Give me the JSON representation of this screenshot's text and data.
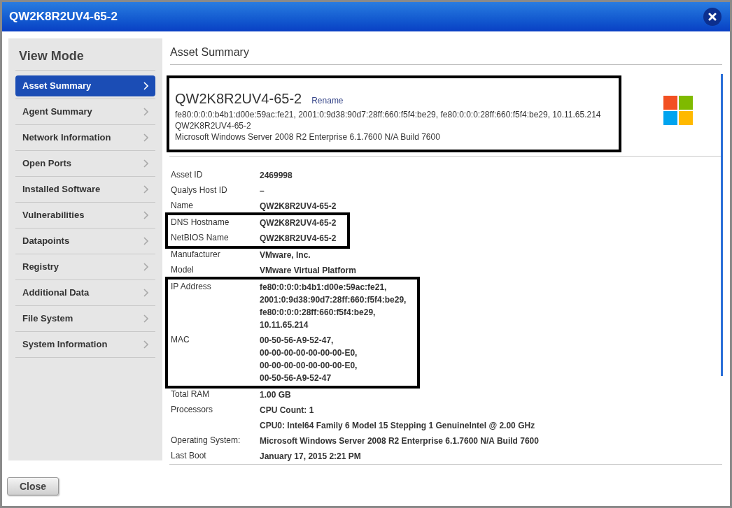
{
  "window": {
    "title": "QW2K8R2UV4-65-2"
  },
  "sidebar": {
    "title": "View Mode",
    "items": [
      {
        "label": "Asset Summary",
        "selected": true
      },
      {
        "label": "Agent Summary",
        "selected": false
      },
      {
        "label": "Network Information",
        "selected": false
      },
      {
        "label": "Open Ports",
        "selected": false
      },
      {
        "label": "Installed Software",
        "selected": false
      },
      {
        "label": "Vulnerabilities",
        "selected": false
      },
      {
        "label": "Datapoints",
        "selected": false
      },
      {
        "label": "Registry",
        "selected": false
      },
      {
        "label": "Additional Data",
        "selected": false
      },
      {
        "label": "File System",
        "selected": false
      },
      {
        "label": "System Information",
        "selected": false
      }
    ]
  },
  "content": {
    "title": "Asset Summary",
    "header": {
      "highlighted": true,
      "name": "QW2K8R2UV4-65-2",
      "rename": "Rename",
      "lines": [
        "fe80:0:0:0:b4b1:d00e:59ac:fe21, 2001:0:9d38:90d7:28ff:660:f5f4:be29, fe80:0:0:0:28ff:660:f5f4:be29, 10.11.65.214",
        "QW2K8R2UV4-65-2",
        "Microsoft Windows Server 2008 R2 Enterprise 6.1.7600 N/A Build 7600"
      ]
    },
    "groups": [
      {
        "highlighted": false,
        "rows": [
          {
            "label": "Asset ID",
            "values": [
              "2469998"
            ]
          },
          {
            "label": "Qualys Host ID",
            "values": [
              "–"
            ]
          },
          {
            "label": "Name",
            "values": [
              "QW2K8R2UV4-65-2"
            ]
          }
        ]
      },
      {
        "highlighted": true,
        "rows": [
          {
            "label": "DNS Hostname",
            "values": [
              "QW2K8R2UV4-65-2"
            ]
          },
          {
            "label": "NetBIOS Name",
            "values": [
              "QW2K8R2UV4-65-2"
            ]
          }
        ]
      },
      {
        "highlighted": false,
        "rows": [
          {
            "label": "Manufacturer",
            "values": [
              "VMware, Inc."
            ]
          },
          {
            "label": "Model",
            "values": [
              "VMware Virtual Platform"
            ]
          }
        ]
      },
      {
        "highlighted": true,
        "rows": [
          {
            "label": "IP Address",
            "values": [
              "fe80:0:0:0:b4b1:d00e:59ac:fe21,",
              "2001:0:9d38:90d7:28ff:660:f5f4:be29,",
              "fe80:0:0:0:28ff:660:f5f4:be29,",
              "10.11.65.214"
            ]
          },
          {
            "label": "MAC",
            "values": [
              "00-50-56-A9-52-47,",
              "00-00-00-00-00-00-00-E0,",
              "00-00-00-00-00-00-00-E0,",
              "00-50-56-A9-52-47"
            ]
          }
        ]
      },
      {
        "highlighted": false,
        "rows": [
          {
            "label": "Total RAM",
            "values": [
              "1.00 GB"
            ]
          },
          {
            "label": "Processors",
            "values": [
              "CPU Count: 1",
              "CPU0: Intel64 Family 6 Model 15 Stepping 1 GenuineIntel @ 2.00 GHz"
            ],
            "spaced": true
          },
          {
            "label": "Operating System:",
            "values": [
              "Microsoft Windows Server 2008 R2 Enterprise 6.1.7600 N/A Build 7600"
            ]
          },
          {
            "label": "Last Boot",
            "values": [
              "January 17, 2015 2:21 PM"
            ]
          }
        ]
      }
    ]
  },
  "footer": {
    "button": "Close"
  }
}
